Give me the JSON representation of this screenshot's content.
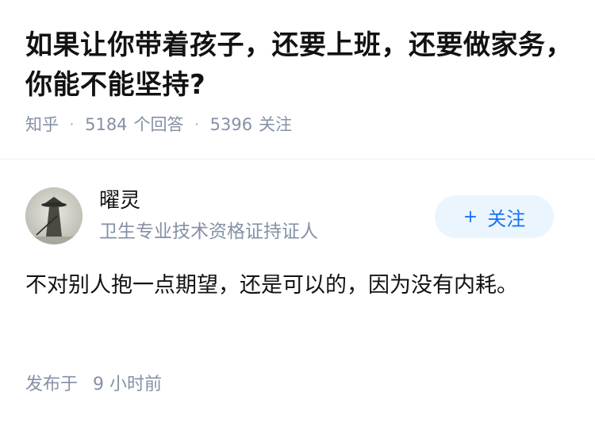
{
  "question": {
    "title": "如果让你带着孩子，还要上班，还要做家务，你能不能坚持?",
    "source": "知乎",
    "answers_count": "5184",
    "answers_label": "个回答",
    "followers_count": "5396",
    "followers_label": "关注"
  },
  "author": {
    "name": "曜灵",
    "bio": "卫生专业技术资格证持证人",
    "avatar_icon": "avatar-icon",
    "follow_label": "关注",
    "follow_icon": "plus-icon"
  },
  "answer": {
    "content": "不对别人抱一点期望，还是可以的，因为没有内耗。",
    "published_label": "发布于",
    "published_time": "9 小时前"
  },
  "colors": {
    "meta_gray": "#8590a6",
    "accent_blue": "#1772f6",
    "button_bg": "#ebf5fd"
  }
}
